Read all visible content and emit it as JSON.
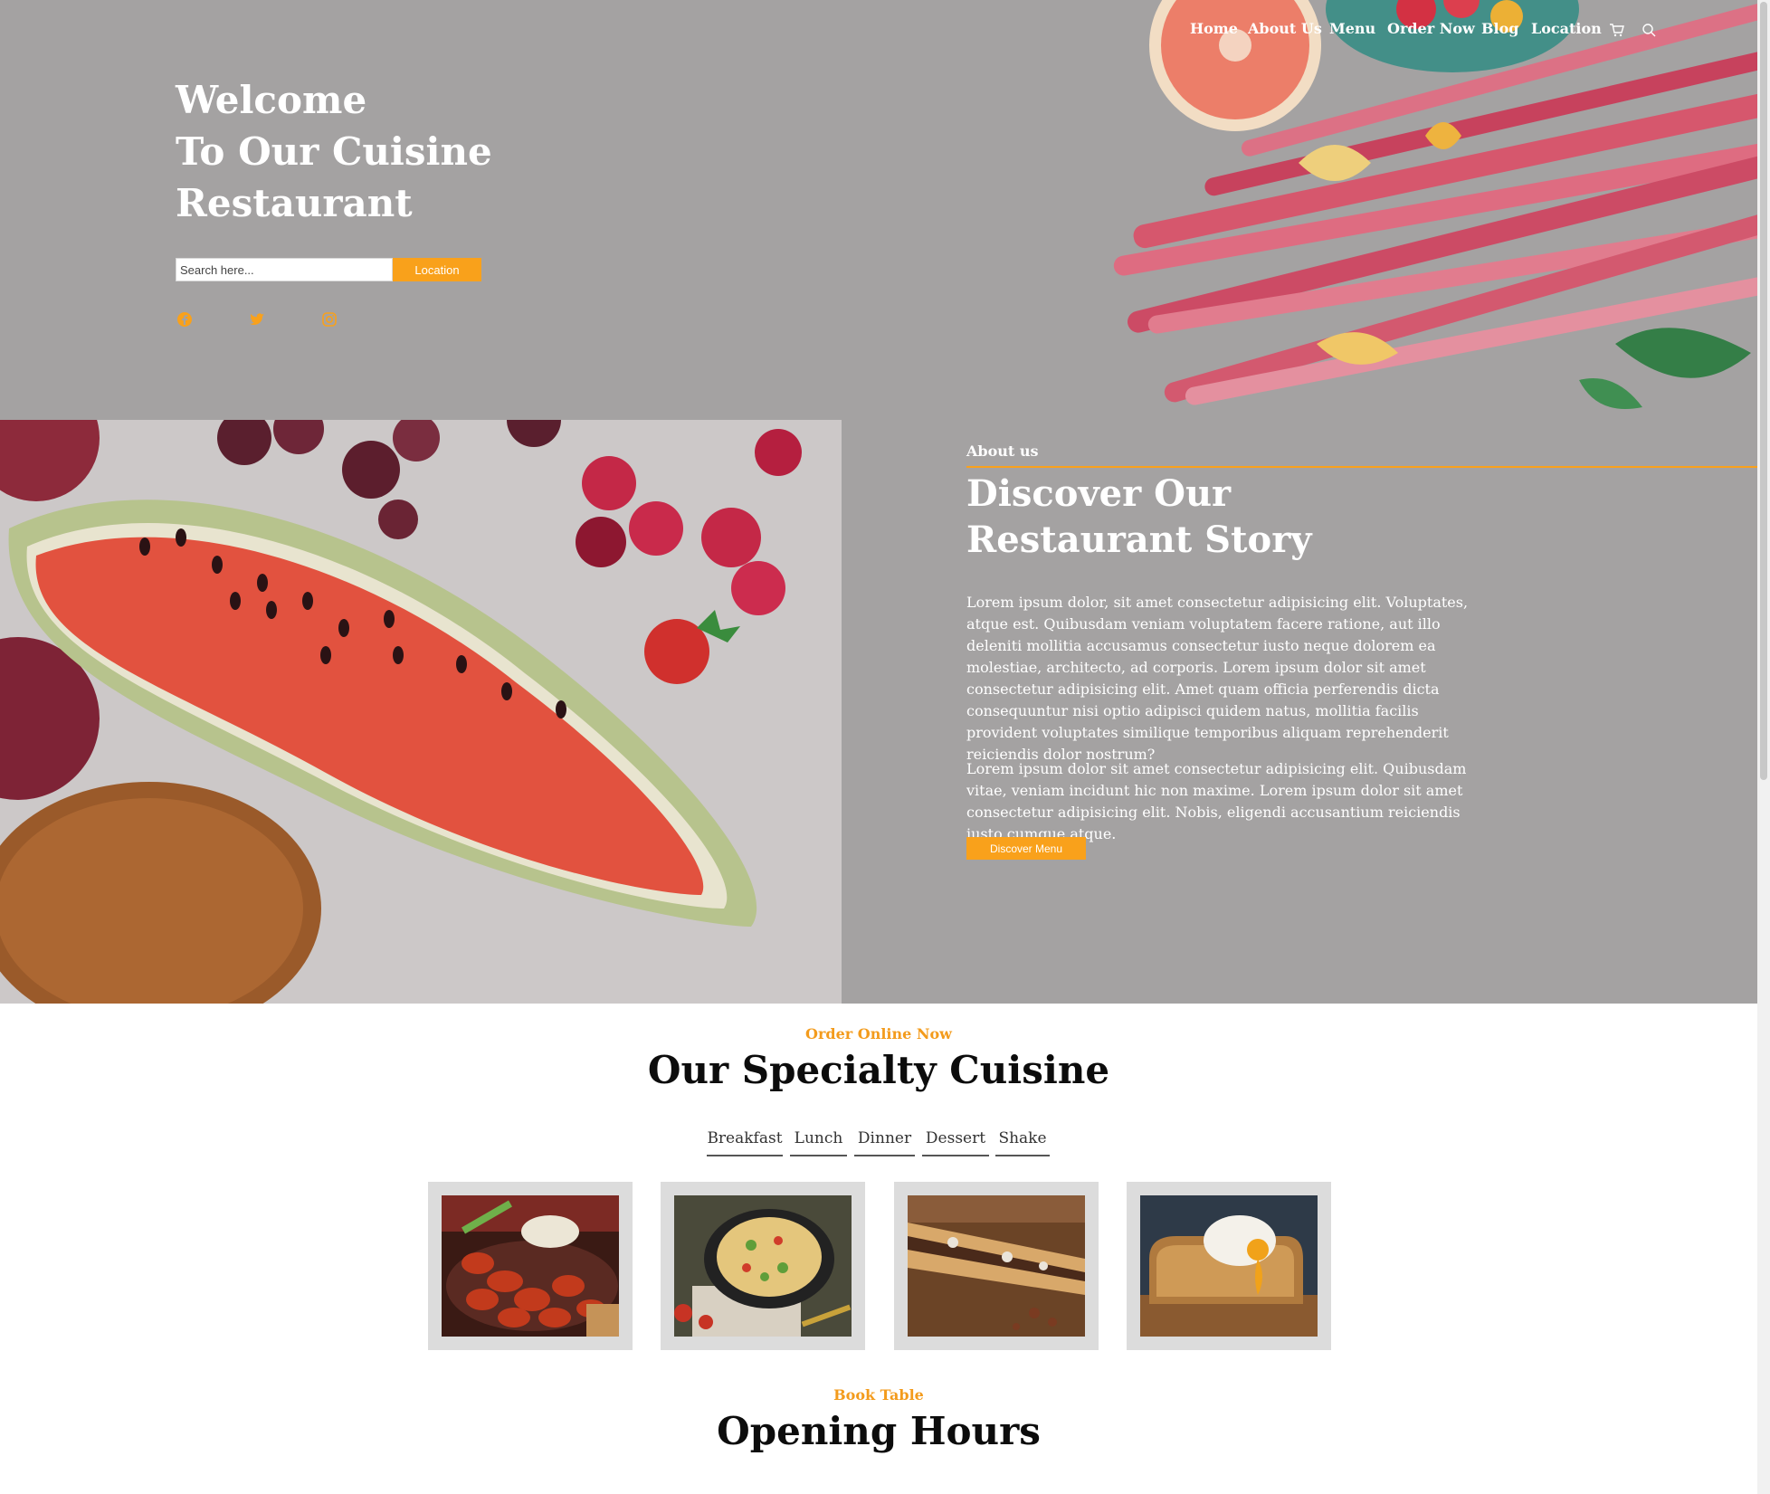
{
  "nav": {
    "items": [
      "Home",
      "About Us",
      "Menu",
      "Order Now",
      "Blog",
      "Location"
    ],
    "icons": [
      "cart-icon",
      "search-icon"
    ]
  },
  "hero": {
    "title_lines": [
      "Welcome",
      "To Our Cuisine",
      "Restaurant"
    ],
    "search_placeholder": "Search here...",
    "location_button": "Location",
    "social_icons": [
      "facebook-icon",
      "twitter-icon",
      "instagram-icon"
    ]
  },
  "about": {
    "eyebrow": "About us",
    "title_lines": [
      "Discover Our",
      "Restaurant Story"
    ],
    "paragraph1": "Lorem ipsum dolor, sit amet consectetur adipisicing elit. Voluptates, atque est. Quibusdam veniam voluptatem facere ratione, aut illo deleniti mollitia accusamus consectetur iusto neque dolorem ea molestiae, architecto, ad corporis. Lorem ipsum dolor sit amet consectetur adipisicing elit. Amet quam officia perferendis dicta consequuntur nisi optio adipisci quidem natus, mollitia facilis provident voluptates similique temporibus aliquam reprehenderit reiciendis dolor nostrum?",
    "paragraph2": "Lorem ipsum dolor sit amet consectetur adipisicing elit. Quibusdam vitae, veniam incidunt hic non maxime. Lorem ipsum dolor sit amet consectetur adipisicing elit. Nobis, eligendi accusantium reiciendis iusto cumque atque.",
    "button": "Discover Menu"
  },
  "specialty": {
    "eyebrow": "Order Online Now",
    "title": "Our Specialty Cuisine",
    "tabs": [
      "Breakfast",
      "Lunch",
      "Dinner",
      "Dessert",
      "Shake"
    ]
  },
  "booking": {
    "eyebrow": "Book Table",
    "title": "Opening Hours"
  },
  "colors": {
    "accent": "#f9a11b",
    "hero_bg": "#a4a2a2",
    "card_bg": "#dcdcdc"
  }
}
